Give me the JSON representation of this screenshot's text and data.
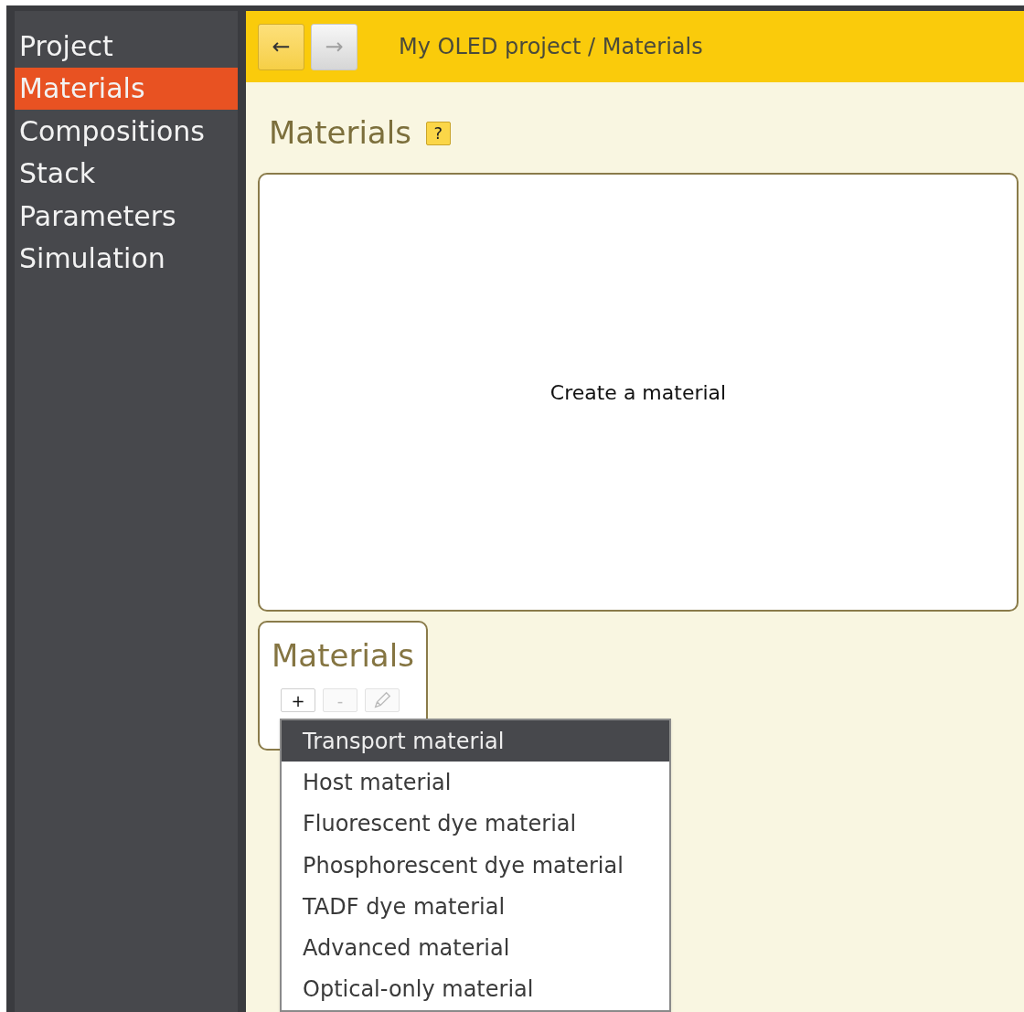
{
  "sidebar": {
    "items": [
      {
        "label": "Project",
        "selected": false
      },
      {
        "label": "Materials",
        "selected": true
      },
      {
        "label": "Compositions",
        "selected": false
      },
      {
        "label": "Stack",
        "selected": false
      },
      {
        "label": "Parameters",
        "selected": false
      },
      {
        "label": "Simulation",
        "selected": false
      }
    ]
  },
  "toolbar": {
    "back": {
      "label": "←",
      "disabled": false
    },
    "forward": {
      "label": "→",
      "disabled": true
    },
    "breadcrumb": "My OLED project / Materials"
  },
  "page": {
    "title": "Materials",
    "help": "?",
    "placeholder_text": "Create a material"
  },
  "materials_panel": {
    "title": "Materials",
    "buttons": [
      {
        "kind": "text",
        "label": "+",
        "disabled": false
      },
      {
        "kind": "text",
        "label": "-",
        "disabled": true
      },
      {
        "kind": "edit",
        "disabled": true
      }
    ]
  },
  "menu": {
    "items": [
      {
        "label": "Transport material",
        "selected": true
      },
      {
        "label": "Host material",
        "selected": false
      },
      {
        "label": "Fluorescent dye material",
        "selected": false
      },
      {
        "label": "Phosphorescent dye material",
        "selected": false
      },
      {
        "label": "TADF dye material",
        "selected": false
      },
      {
        "label": "Advanced material",
        "selected": false
      },
      {
        "label": "Optical-only material",
        "selected": false
      }
    ]
  }
}
